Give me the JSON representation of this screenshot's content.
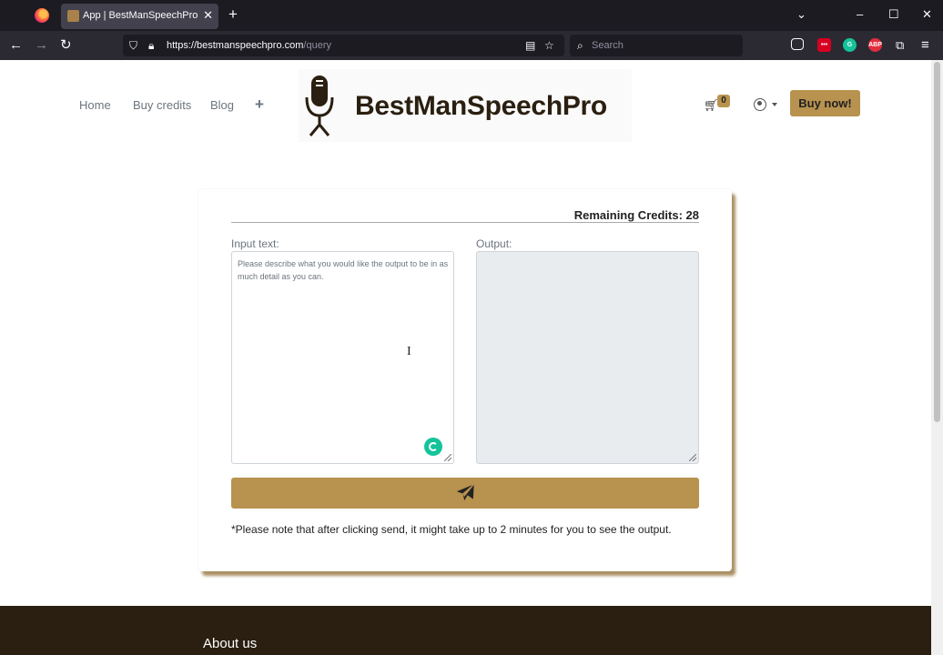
{
  "browser": {
    "tab_title": "App | BestManSpeechPro",
    "tab_close": "✕",
    "new_tab": "+",
    "url_domain": "https://bestmanspeechpro.com",
    "url_path": "/query",
    "search_placeholder": "Search",
    "window_controls": {
      "minimize": "–",
      "maximize": "☐",
      "close": "✕",
      "list_tabs": "⌄"
    }
  },
  "site": {
    "nav": {
      "home": "Home",
      "buy_credits": "Buy credits",
      "blog": "Blog",
      "plus": "+"
    },
    "logo_text": "BestManSpeechPro",
    "cart_count": "0",
    "buy_now": "Buy now!"
  },
  "query": {
    "remaining_credits_label": "Remaining Credits: 28",
    "input_label": "Input text:",
    "input_placeholder": "Please describe what you would like the output to be in as much detail as you can.",
    "output_label": "Output:",
    "note": "*Please note that after clicking send, it might take up to 2 minutes for you to see the output."
  },
  "footer": {
    "about_title": "About us"
  },
  "colors": {
    "accent": "#b8924f",
    "dark_brown": "#2a1f10",
    "output_bg": "#e9ecef",
    "grammarly": "#15c39a"
  },
  "icons": [
    "firefox-logo-icon",
    "shield-icon",
    "lock-icon",
    "reader-icon",
    "star-icon",
    "search-icon",
    "pocket-icon",
    "grammarly-icon",
    "adblock-icon",
    "extensions-icon",
    "menu-icon",
    "cart-icon",
    "user-icon",
    "send-icon"
  ]
}
